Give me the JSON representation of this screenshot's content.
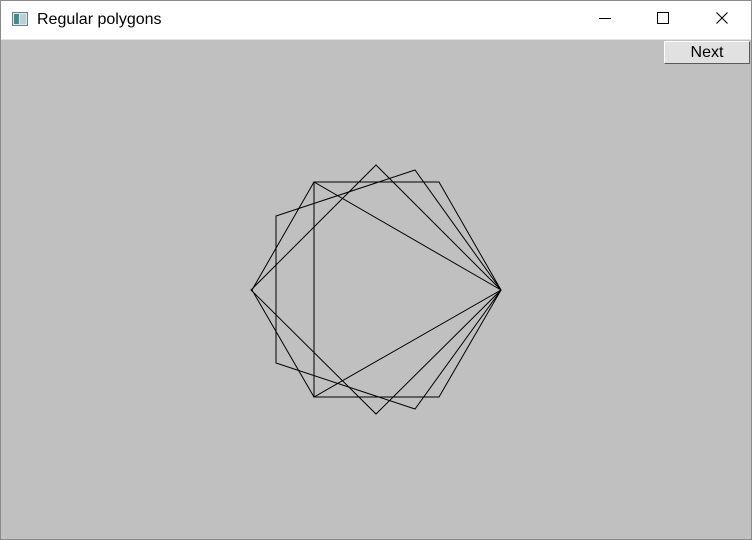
{
  "window": {
    "title": "Regular polygons",
    "icon": "window-app-icon",
    "controls": [
      "minimize-icon",
      "maximize-icon",
      "close-icon"
    ]
  },
  "toolbar": {
    "next_label": "Next"
  },
  "colors": {
    "client_background": "#c0c0c0",
    "stroke": "#000000",
    "titlebar": "#ffffff"
  },
  "drawing": {
    "shapes": [
      {
        "name": "triangle",
        "sides": 3
      },
      {
        "name": "square",
        "sides": 4
      },
      {
        "name": "pentagon",
        "sides": 5
      },
      {
        "name": "hexagon",
        "sides": 6
      }
    ]
  }
}
